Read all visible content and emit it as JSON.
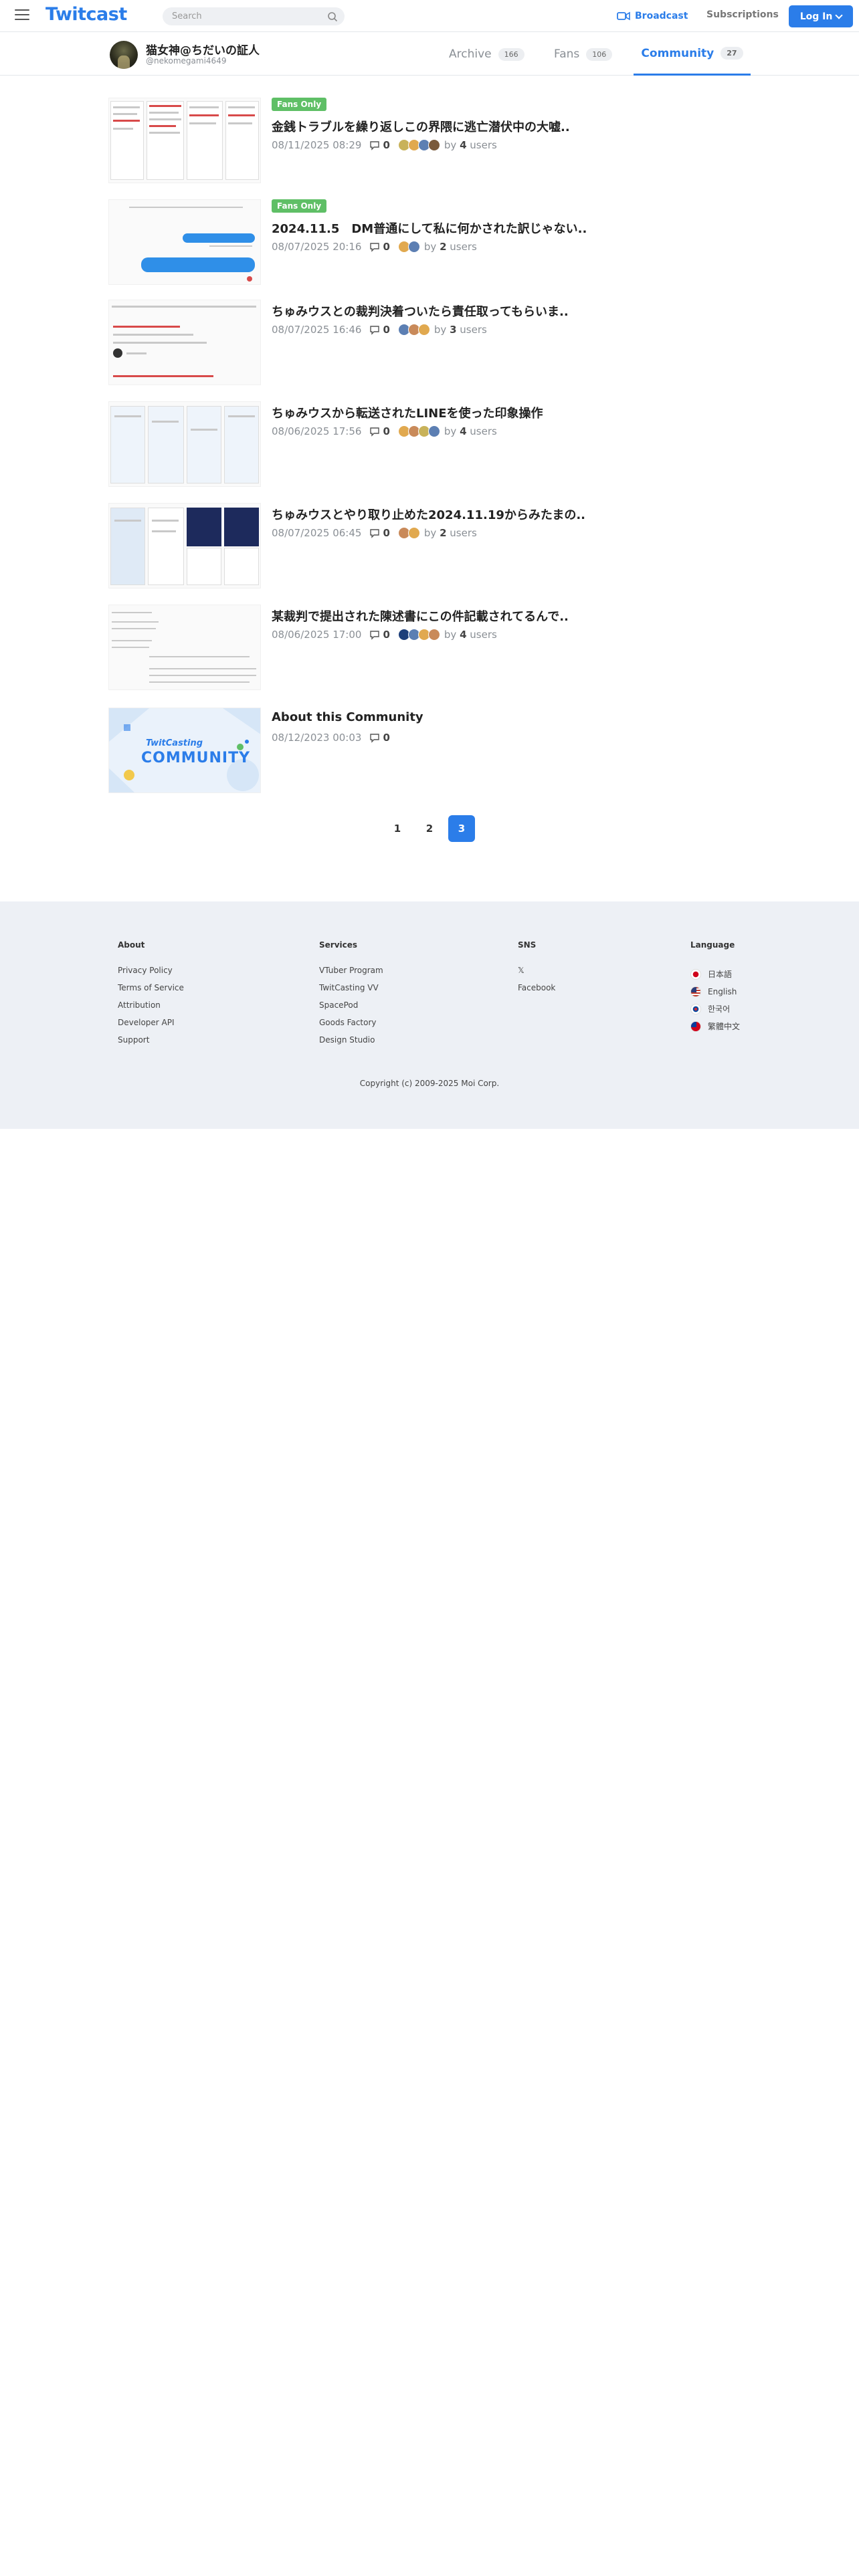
{
  "header": {
    "logo": "Twitcast",
    "search_placeholder": "Search",
    "broadcast_label": "Broadcast",
    "subscriptions_label": "Subscriptions",
    "login_label": "Log In"
  },
  "profile": {
    "name": "猫女神@ちだいの証人",
    "id": "@nekomegami4649",
    "tabs": [
      {
        "label": "Archive",
        "count": "166"
      },
      {
        "label": "Fans",
        "count": "106"
      },
      {
        "label": "Community",
        "count": "27"
      }
    ]
  },
  "posts": [
    {
      "badge": "Fans Only",
      "title": "金銭トラブルを繰り返しこの界隈に逃亡潜伏中の大嘘..",
      "date": "08/11/2025 08:29",
      "comments": "0",
      "by": "by",
      "users_count": "4",
      "users_word": "users"
    },
    {
      "badge": "Fans Only",
      "title": "2024.11.5　DM普通にして私に何かされた訳じゃない..",
      "date": "08/07/2025 20:16",
      "comments": "0",
      "by": "by",
      "users_count": "2",
      "users_word": "users"
    },
    {
      "title": "ちゅみウスとの裁判決着ついたら責任取ってもらいま..",
      "date": "08/07/2025 16:46",
      "comments": "0",
      "by": "by",
      "users_count": "3",
      "users_word": "users"
    },
    {
      "title": "ちゅみウスから転送されたLINEを使った印象操作",
      "date": "08/06/2025 17:56",
      "comments": "0",
      "by": "by",
      "users_count": "4",
      "users_word": "users"
    },
    {
      "title": "ちゅみウスとやり取り止めた2024.11.19からみたまの..",
      "date": "08/07/2025 06:45",
      "comments": "0",
      "by": "by",
      "users_count": "2",
      "users_word": "users"
    },
    {
      "title": "某裁判で提出された陳述書にこの件記載されてるんで..",
      "date": "08/06/2025 17:00",
      "comments": "0",
      "by": "by",
      "users_count": "4",
      "users_word": "users"
    },
    {
      "title": "About this Community",
      "date": "08/12/2023 00:03",
      "comments": "0"
    }
  ],
  "about_thumb": {
    "brand": "TwitCasting",
    "word": "COMMUNITY"
  },
  "pagination": [
    "1",
    "2",
    "3"
  ],
  "footer": {
    "about": {
      "heading": "About",
      "links": [
        "Privacy Policy",
        "Terms of Service",
        "Attribution",
        "Developer API",
        "Support"
      ]
    },
    "services": {
      "heading": "Services",
      "links": [
        "VTuber Program",
        "TwitCasting VV",
        "SpacePod",
        "Goods Factory",
        "Design Studio"
      ]
    },
    "sns": {
      "heading": "SNS",
      "links": [
        "𝕏",
        "Facebook"
      ]
    },
    "language": {
      "heading": "Language",
      "links": [
        "日本語",
        "English",
        "한국어",
        "繁體中文"
      ]
    },
    "copyright": "Copyright (c) 2009-2025 Moi Corp."
  }
}
